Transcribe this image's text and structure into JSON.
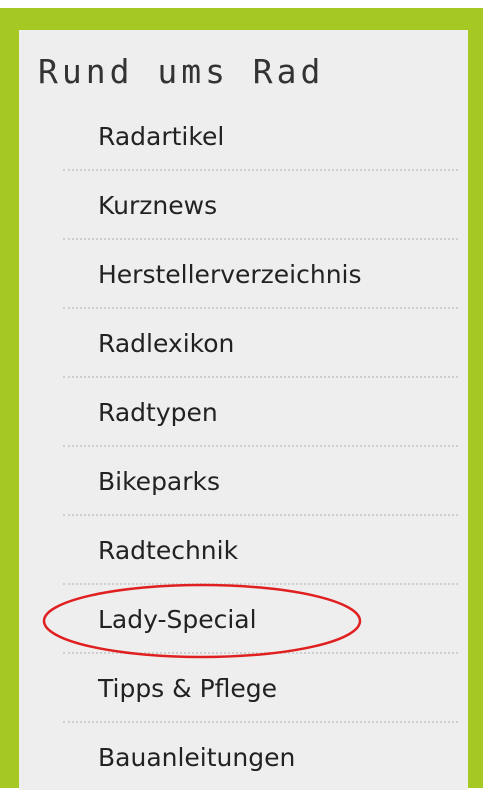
{
  "nav": {
    "title": "Rund ums Rad",
    "items": [
      {
        "label": "Radartikel"
      },
      {
        "label": "Kurznews"
      },
      {
        "label": "Herstellerverzeichnis"
      },
      {
        "label": "Radlexikon"
      },
      {
        "label": "Radtypen"
      },
      {
        "label": "Bikeparks"
      },
      {
        "label": "Radtechnik"
      },
      {
        "label": "Lady-Special"
      },
      {
        "label": "Tipps & Pflege"
      },
      {
        "label": "Bauanleitungen"
      }
    ]
  },
  "colors": {
    "frame_green": "#a6c823",
    "panel_background": "#eeeeee",
    "highlight_circle": "#e02020"
  },
  "annotation": {
    "highlighted_item": "Lady-Special",
    "shape": "red-ellipse"
  }
}
